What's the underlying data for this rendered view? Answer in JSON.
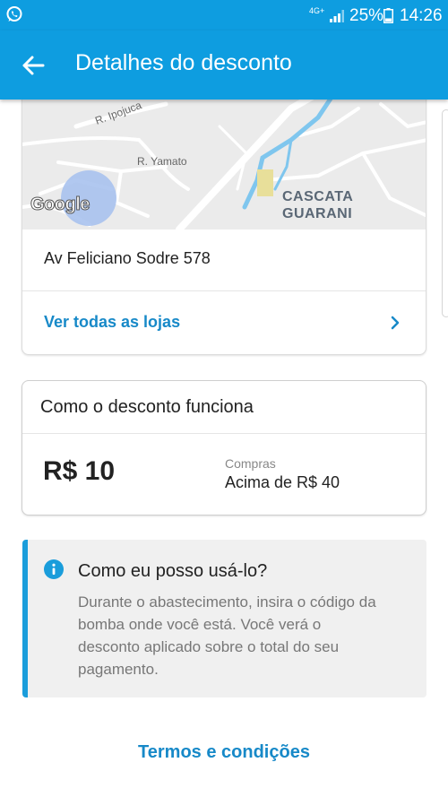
{
  "status_bar": {
    "network": "4G+",
    "battery": "25%",
    "time": "14:26",
    "left_icon": "whatsapp-icon"
  },
  "header": {
    "title": "Detalhes do desconto",
    "back_icon": "arrow-left-icon"
  },
  "store": {
    "map": {
      "street_labels": [
        "R. Ipojuca",
        "R. Yamato"
      ],
      "place_label": "CASCATA GUARANI",
      "provider": "Google"
    },
    "address": "Av Feliciano Sodre 578",
    "see_all_label": "Ver todas as lojas"
  },
  "how_it_works": {
    "title": "Como o desconto funciona",
    "amount": "R$ 10",
    "condition_label": "Compras",
    "condition_value": "Acima de R$ 40"
  },
  "info": {
    "question": "Como eu posso usá-lo?",
    "text": "Durante o abastecimento, insira o código da bomba onde você está. Você verá o desconto aplicado sobre o total do seu pagamento.",
    "icon": "info-icon",
    "accent": "#1a9ddb"
  },
  "footer": {
    "terms_label": "Termos e condições"
  },
  "colors": {
    "primary": "#0e9de0",
    "link": "#1789c8"
  }
}
